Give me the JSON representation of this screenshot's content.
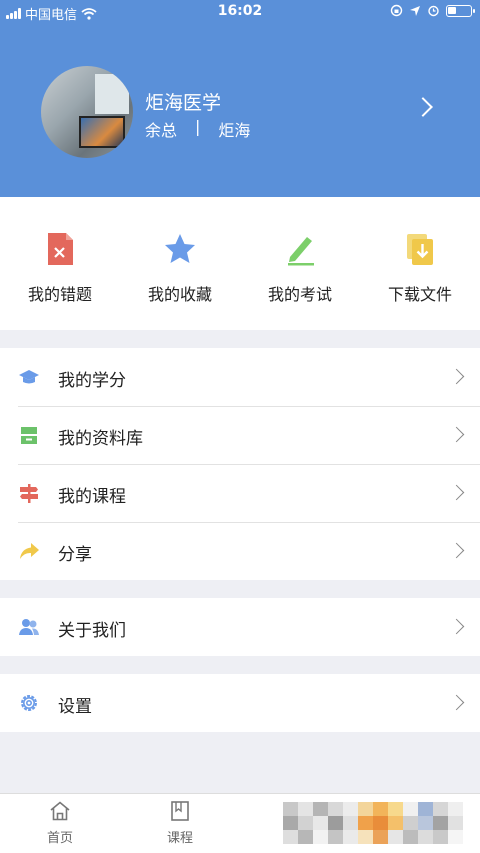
{
  "status_bar": {
    "carrier": "中国电信",
    "time": "16:02"
  },
  "profile": {
    "name": "炬海医学",
    "role": "余总",
    "separator": "|",
    "org": "炬海"
  },
  "quick_actions": [
    {
      "label": "我的错题",
      "icon": "wrong-file-icon"
    },
    {
      "label": "我的收藏",
      "icon": "star-icon"
    },
    {
      "label": "我的考试",
      "icon": "pencil-icon"
    },
    {
      "label": "下载文件",
      "icon": "download-file-icon"
    }
  ],
  "menu": {
    "group1": [
      {
        "label": "我的学分",
        "icon": "graduation-cap-icon"
      },
      {
        "label": "我的资料库",
        "icon": "archive-icon"
      },
      {
        "label": "我的课程",
        "icon": "signpost-icon"
      },
      {
        "label": "分享",
        "icon": "share-arrow-icon"
      }
    ],
    "group2": [
      {
        "label": "关于我们",
        "icon": "users-icon"
      }
    ],
    "group3": [
      {
        "label": "设置",
        "icon": "gear-icon"
      }
    ]
  },
  "tab_bar": [
    {
      "label": "首页",
      "icon": "home-icon"
    },
    {
      "label": "课程",
      "icon": "book-icon"
    }
  ],
  "colors": {
    "header_bg": "#5a90d9",
    "page_bg": "#eeeff4",
    "star": "#6a9be8",
    "wrong": "#e3685c",
    "pencil": "#7ccf6a",
    "download": "#f0c84a"
  }
}
